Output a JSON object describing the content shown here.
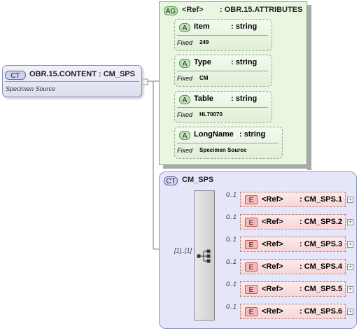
{
  "root": {
    "badge": "CT",
    "title": "OBR.15.CONTENT : CM_SPS",
    "subtitle": "Specimen Source"
  },
  "attribute_group": {
    "badge": "AG",
    "ref_label": "<Ref>",
    "name": ": OBR.15.ATTRIBUTES",
    "attributes": [
      {
        "badge": "A",
        "name": "Item",
        "type": ": string",
        "fixed_label": "Fixed",
        "fixed_value": "249"
      },
      {
        "badge": "A",
        "name": "Type",
        "type": ": string",
        "fixed_label": "Fixed",
        "fixed_value": "CM"
      },
      {
        "badge": "A",
        "name": "Table",
        "type": ": string",
        "fixed_label": "Fixed",
        "fixed_value": "HL70070"
      },
      {
        "badge": "A",
        "name": "LongName",
        "type": ": string",
        "fixed_label": "Fixed",
        "fixed_value": "Specimen Source"
      }
    ]
  },
  "complex_type": {
    "badge": "CT",
    "name": "CM_SPS",
    "sequence_cardinality": "[1]..[1]",
    "elements": [
      {
        "badge": "E",
        "ref": "<Ref>",
        "name": ": CM_SPS.1",
        "cardinality": "0..1"
      },
      {
        "badge": "E",
        "ref": "<Ref>",
        "name": ": CM_SPS.2",
        "cardinality": "0..1"
      },
      {
        "badge": "E",
        "ref": "<Ref>",
        "name": ": CM_SPS.3",
        "cardinality": "0..1"
      },
      {
        "badge": "E",
        "ref": "<Ref>",
        "name": ": CM_SPS.4",
        "cardinality": "0..1"
      },
      {
        "badge": "E",
        "ref": "<Ref>",
        "name": ": CM_SPS.5",
        "cardinality": "0..1"
      },
      {
        "badge": "E",
        "ref": "<Ref>",
        "name": ": CM_SPS.6",
        "cardinality": "0..1"
      }
    ],
    "expand_symbol": "+"
  }
}
